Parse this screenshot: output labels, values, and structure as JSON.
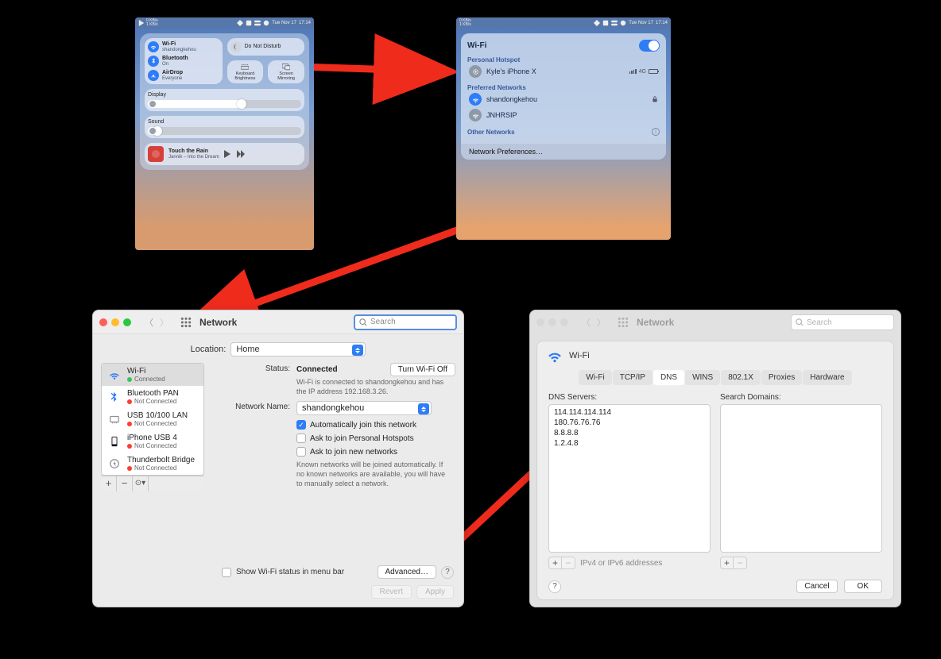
{
  "menubar": {
    "netspeed_up": "0 KB/s",
    "netspeed_down": "1 KB/s",
    "date": "Tue Nov 17",
    "time": "17:14"
  },
  "control_center": {
    "wifi": {
      "title": "Wi-Fi",
      "sub": "shandongkehou"
    },
    "bluetooth": {
      "title": "Bluetooth",
      "sub": "On"
    },
    "airdrop": {
      "title": "AirDrop",
      "sub": "Everyone"
    },
    "dnd": "Do Not Disturb",
    "keyboard": "Keyboard Brightness",
    "mirror": "Screen Mirroring",
    "display": "Display",
    "sound": "Sound",
    "song_title": "Touch the Rain",
    "song_artist": "Jannik – Into the Dream"
  },
  "wifi_popup": {
    "title": "Wi-Fi",
    "hotspot_label": "Personal Hotspot",
    "hotspot_name": "Kyle's iPhone X",
    "hotspot_signal": "4G",
    "preferred_label": "Preferred Networks",
    "pref": [
      "shandongkehou",
      "JNHRSIP"
    ],
    "other_label": "Other Networks",
    "prefs_link": "Network Preferences…"
  },
  "netprefs": {
    "title": "Network",
    "search_ph": "Search",
    "location_label": "Location:",
    "location_value": "Home",
    "services": [
      {
        "name": "Wi-Fi",
        "status": "Connected",
        "dot": "grn",
        "icon": "wifi",
        "color": "#2e7cf6"
      },
      {
        "name": "Bluetooth PAN",
        "status": "Not Connected",
        "dot": "red",
        "icon": "bt",
        "color": "#2e7cf6"
      },
      {
        "name": "USB 10/100 LAN",
        "status": "Not Connected",
        "dot": "red",
        "icon": "eth",
        "color": "#8e8e93"
      },
      {
        "name": "iPhone USB 4",
        "status": "Not Connected",
        "dot": "red",
        "icon": "phone",
        "color": "#111"
      },
      {
        "name": "Thunderbolt Bridge",
        "status": "Not Connected",
        "dot": "red",
        "icon": "tb",
        "color": "#8e8e93"
      }
    ],
    "status_label": "Status:",
    "status_value": "Connected",
    "turn_off": "Turn Wi-Fi Off",
    "status_desc": "Wi-Fi is connected to shandongkehou and has the IP address 192.168.3.26.",
    "netname_label": "Network Name:",
    "netname_value": "shandongkehou",
    "auto_join": "Automatically join this network",
    "ask_hotspot": "Ask to join Personal Hotspots",
    "ask_new": "Ask to join new networks",
    "ask_desc": "Known networks will be joined automatically. If no known networks are available, you will have to manually select a network.",
    "show_menu": "Show Wi-Fi status in menu bar",
    "advanced": "Advanced…",
    "revert": "Revert",
    "apply": "Apply"
  },
  "dns": {
    "title": "Network",
    "sheet_title": "Wi-Fi",
    "tabs": [
      "Wi-Fi",
      "TCP/IP",
      "DNS",
      "WINS",
      "802.1X",
      "Proxies",
      "Hardware"
    ],
    "dns_label": "DNS Servers:",
    "search_label": "Search Domains:",
    "servers": [
      "114.114.114.114",
      "180.76.76.76",
      "8.8.8.8",
      "1.2.4.8"
    ],
    "hint": "IPv4 or IPv6 addresses",
    "cancel": "Cancel",
    "ok": "OK",
    "search_ph": "Search"
  }
}
